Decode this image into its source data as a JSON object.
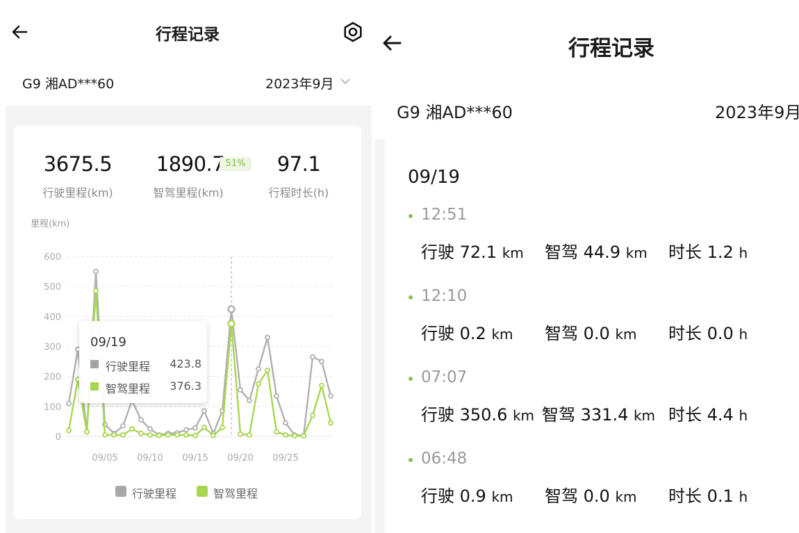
{
  "left": {
    "title": "行程记录",
    "plate": "G9 湘AD***60",
    "month": "2023年9月",
    "stats": {
      "drive_value": "3675.5",
      "drive_label": "行驶里程(km)",
      "smart_value": "1890.7",
      "smart_pct": "51%",
      "smart_label": "智驾里程(km)",
      "duration_value": "97.1",
      "duration_label": "行程时长(h)"
    },
    "tooltip": {
      "date": "09/19",
      "drive_label": "行驶里程",
      "drive_value": "423.8",
      "smart_label": "智驾里程",
      "smart_value": "376.3"
    },
    "legend": {
      "drive": "行驶里程",
      "smart": "智驾里程"
    }
  },
  "chart_data": {
    "type": "line",
    "ylabel": "里程(km)",
    "ylim": [
      0,
      600
    ],
    "yticks": [
      "0",
      "100",
      "200",
      "300",
      "400",
      "500",
      "600"
    ],
    "xticks": [
      "09/05",
      "09/10",
      "09/15",
      "09/20",
      "09/25"
    ],
    "x": [
      "09/01",
      "09/02",
      "09/03",
      "09/04",
      "09/05",
      "09/06",
      "09/07",
      "09/08",
      "09/09",
      "09/10",
      "09/11",
      "09/12",
      "09/13",
      "09/14",
      "09/15",
      "09/16",
      "09/17",
      "09/18",
      "09/19",
      "09/20",
      "09/21",
      "09/22",
      "09/23",
      "09/24",
      "09/25",
      "09/26",
      "09/27",
      "09/28",
      "09/29",
      "09/30"
    ],
    "series": [
      {
        "name": "行驶里程",
        "color": "#b0b0b0",
        "values": [
          110,
          290,
          15,
          550,
          40,
          10,
          35,
          120,
          55,
          25,
          5,
          10,
          12,
          22,
          28,
          85,
          10,
          85,
          424,
          155,
          120,
          225,
          330,
          135,
          45,
          5,
          3,
          265,
          250,
          135
        ]
      },
      {
        "name": "智驾里程",
        "color": "#a7d74e",
        "values": [
          20,
          190,
          15,
          485,
          5,
          5,
          5,
          25,
          10,
          5,
          3,
          5,
          5,
          5,
          3,
          30,
          3,
          30,
          376,
          8,
          5,
          175,
          220,
          15,
          5,
          2,
          2,
          70,
          170,
          45
        ]
      }
    ],
    "highlight": "09/19",
    "grid": true,
    "legend": "bottom"
  },
  "right": {
    "title": "行程记录",
    "plate": "G9 湘AD***60",
    "month": "2023年9月",
    "day": "09/19",
    "trips": [
      {
        "time": "12:51",
        "drive_label": "行驶",
        "drive": "72.1",
        "smart_label": "智驾",
        "smart": "44.9",
        "dur_label": "时长",
        "dur": "1.2"
      },
      {
        "time": "12:10",
        "drive_label": "行驶",
        "drive": "0.2",
        "smart_label": "智驾",
        "smart": "0.0",
        "dur_label": "时长",
        "dur": "0.0"
      },
      {
        "time": "07:07",
        "drive_label": "行驶",
        "drive": "350.6",
        "smart_label": "智驾",
        "smart": "331.4",
        "dur_label": "时长",
        "dur": "4.4"
      },
      {
        "time": "06:48",
        "drive_label": "行驶",
        "drive": "0.9",
        "smart_label": "智驾",
        "smart": "0.0",
        "dur_label": "时长",
        "dur": "0.1"
      }
    ],
    "unit_km": "km",
    "unit_h": "h"
  }
}
